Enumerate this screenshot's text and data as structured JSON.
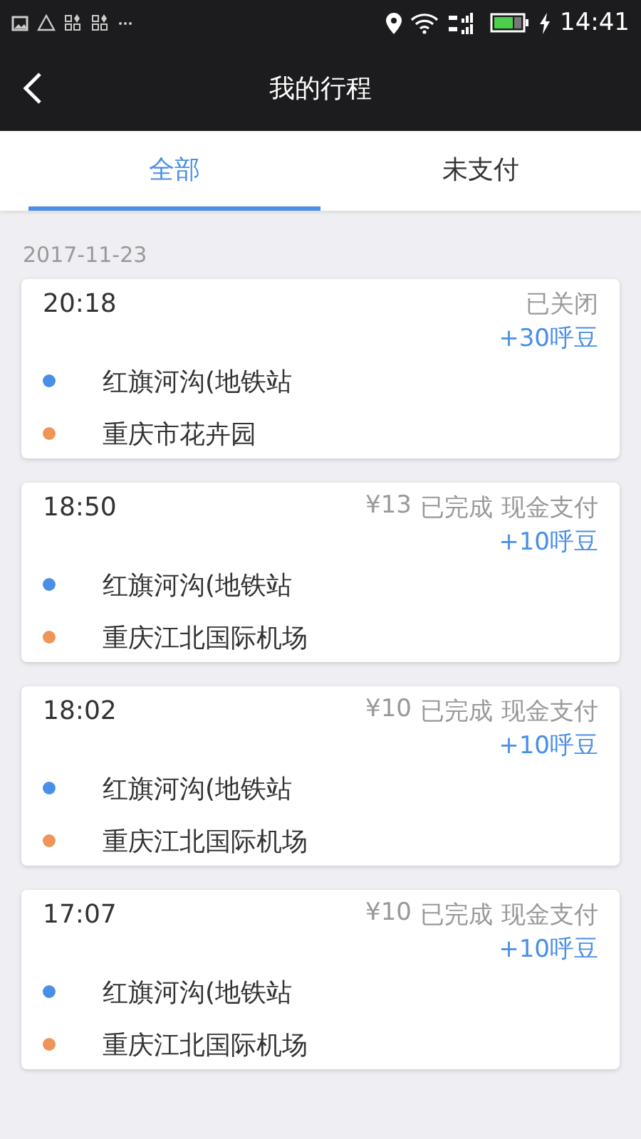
{
  "status_bar": {
    "time": "14:41"
  },
  "header": {
    "title": "我的行程"
  },
  "tabs": [
    {
      "label": "全部",
      "selected": true
    },
    {
      "label": "未支付",
      "selected": false
    }
  ],
  "date": "2017-11-23",
  "trips": [
    {
      "time": "20:18",
      "status": "已关闭",
      "points": "+30呼豆",
      "stops": [
        {
          "name": "红旗河沟(地铁站",
          "color": "#4a8fe7"
        },
        {
          "name": "重庆市花卉园",
          "color": "#f0955a"
        }
      ]
    },
    {
      "time": "18:50",
      "price": "¥13",
      "status": "已完成",
      "payment": "现金支付",
      "points": "+10呼豆",
      "stops": [
        {
          "name": "红旗河沟(地铁站",
          "color": "#4a8fe7"
        },
        {
          "name": "重庆江北国际机场",
          "color": "#f0955a"
        }
      ]
    },
    {
      "time": "18:02",
      "price": "¥10",
      "status": "已完成",
      "payment": "现金支付",
      "points": "+10呼豆",
      "stops": [
        {
          "name": "红旗河沟(地铁站",
          "color": "#4a8fe7"
        },
        {
          "name": "重庆江北国际机场",
          "color": "#f0955a"
        }
      ]
    },
    {
      "time": "17:07",
      "price": "¥10",
      "status": "已完成",
      "payment": "现金支付",
      "points": "+10呼豆",
      "stops": [
        {
          "name": "红旗河沟(地铁站",
          "color": "#4a8fe7"
        },
        {
          "name": "重庆江北国际机场",
          "color": "#f0955a"
        }
      ]
    }
  ]
}
